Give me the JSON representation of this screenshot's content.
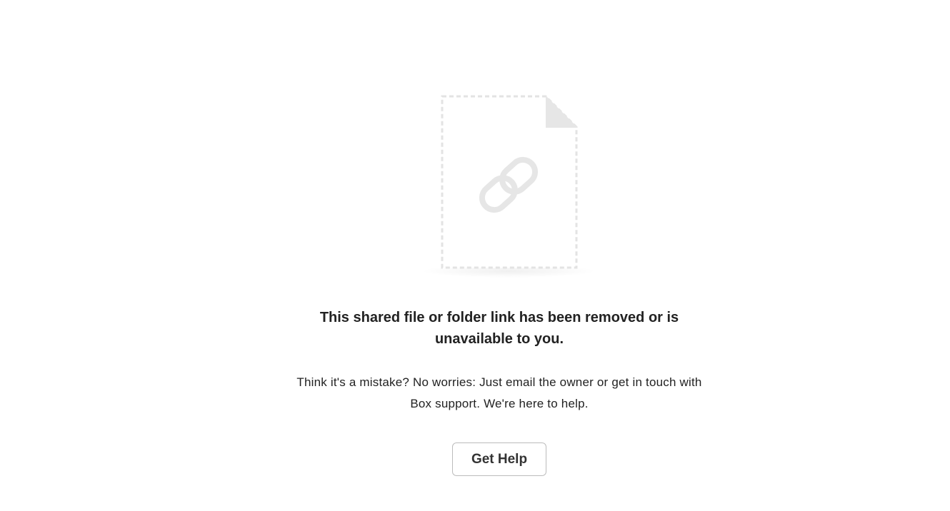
{
  "error_state": {
    "icon": "broken-link-file-icon",
    "title": "This shared file or folder link has been removed or is unavailable to you.",
    "message": "Think it's a mistake? No worries: Just email the owner or get in touch with Box support. We're here to help.",
    "help_button_label": "Get Help"
  },
  "colors": {
    "illustration_gray": "#e6e6e6",
    "text": "#222222",
    "button_border": "#bcbcbc"
  }
}
